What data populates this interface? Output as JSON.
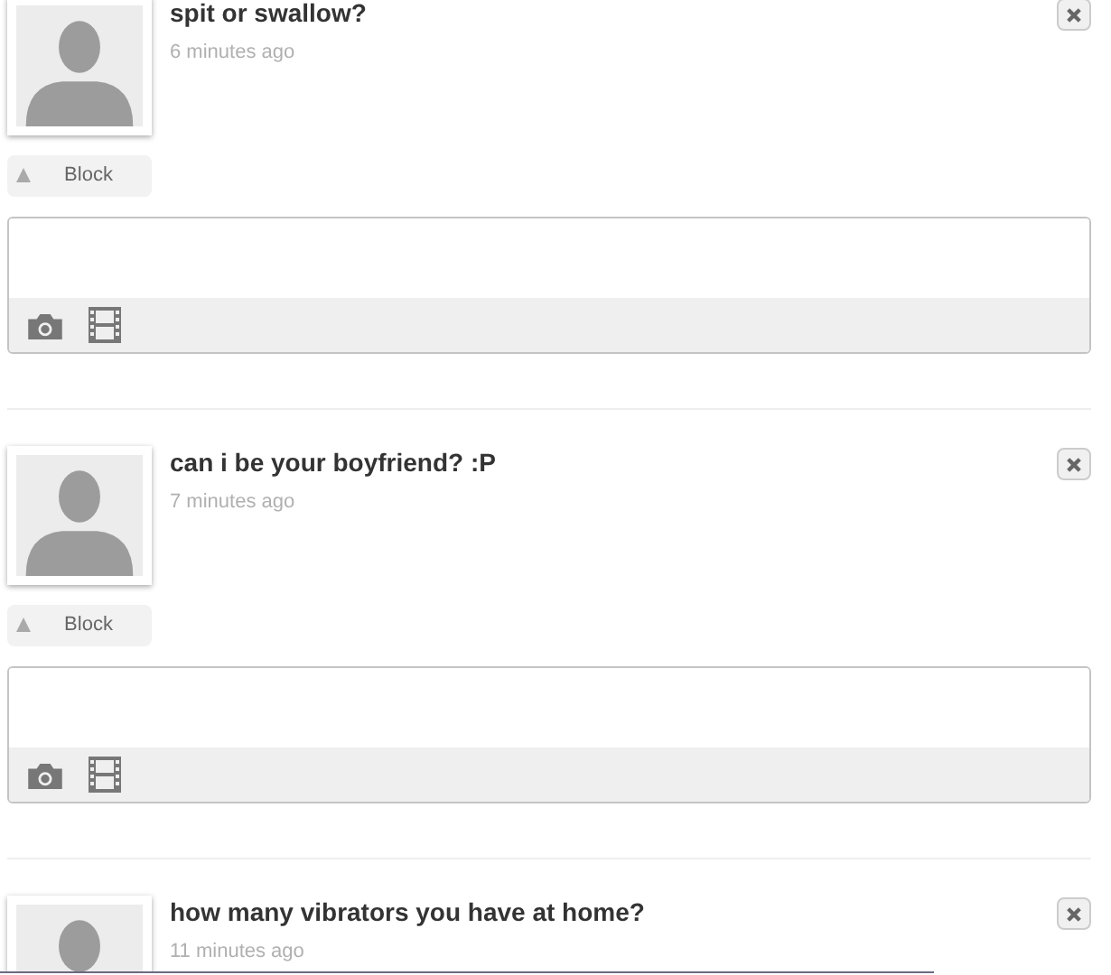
{
  "questions": [
    {
      "text": "spit or swallow?",
      "time": "6 minutes ago",
      "block": "Block"
    },
    {
      "text": "can i be your boyfriend? :P",
      "time": "7 minutes ago",
      "block": "Block"
    },
    {
      "text": "how many vibrators you have at home?",
      "time": "11 minutes ago"
    }
  ]
}
